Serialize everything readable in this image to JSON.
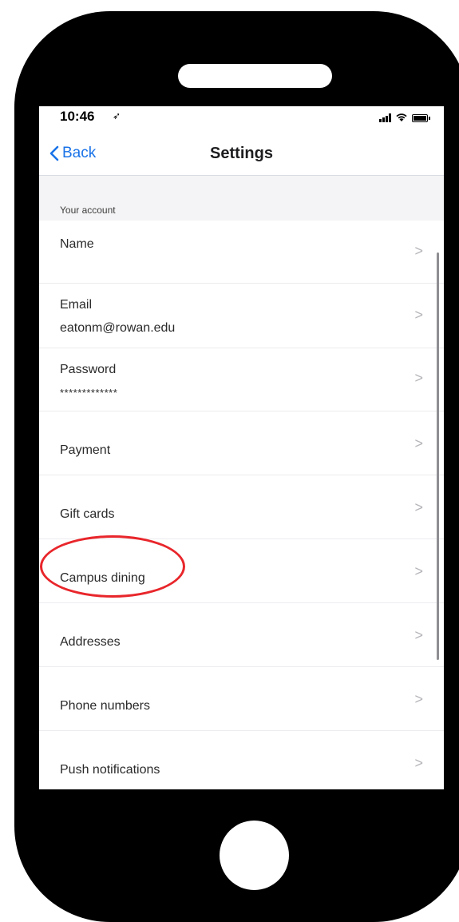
{
  "status_bar": {
    "time": "10:46",
    "location_icon": "location-arrow-icon",
    "signal_icon": "cellular-signal-icon",
    "wifi_icon": "wifi-icon",
    "battery_icon": "battery-icon"
  },
  "nav": {
    "back_label": "Back",
    "back_icon": "chevron-left-icon",
    "title": "Settings"
  },
  "section": {
    "header": "Your account"
  },
  "rows": [
    {
      "label": "Name",
      "value": ""
    },
    {
      "label": "Email",
      "value": "eatonm@rowan.edu"
    },
    {
      "label": "Password",
      "value": "*************"
    },
    {
      "label": "Payment",
      "value": ""
    },
    {
      "label": "Gift cards",
      "value": ""
    },
    {
      "label": "Campus dining",
      "value": ""
    },
    {
      "label": "Addresses",
      "value": ""
    },
    {
      "label": "Phone numbers",
      "value": ""
    },
    {
      "label": "Push notifications",
      "value": ""
    }
  ],
  "chevron_glyph": ">",
  "colors": {
    "accent": "#1a73e8",
    "highlight": "#e8262b",
    "frame": "#000000"
  }
}
